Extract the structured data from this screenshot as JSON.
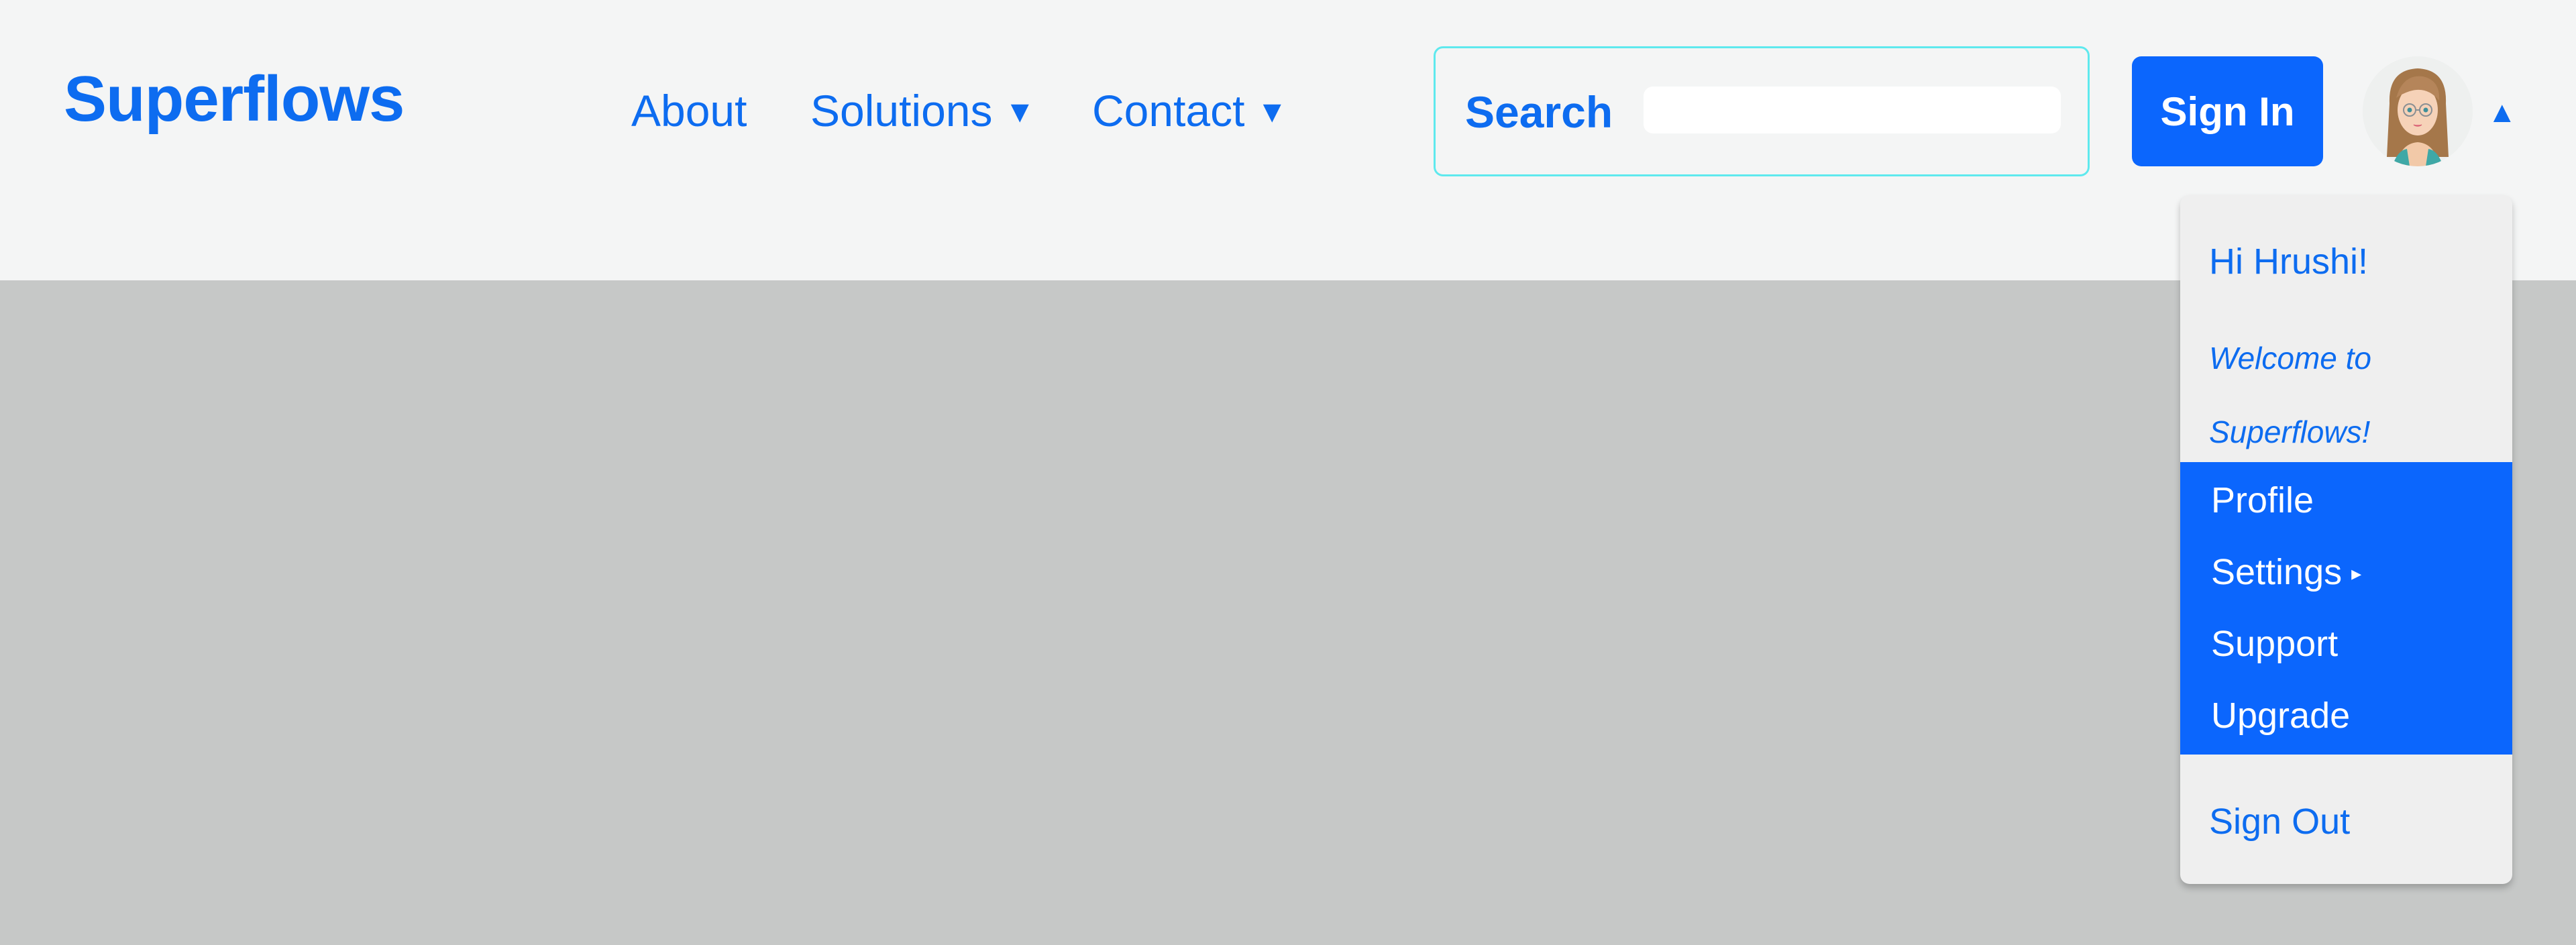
{
  "brand": {
    "name": "Superflows"
  },
  "nav": {
    "about": "About",
    "solutions": "Solutions",
    "contact": "Contact",
    "dropdown_caret": "▼"
  },
  "search": {
    "label": "Search",
    "value": "",
    "placeholder": ""
  },
  "auth": {
    "sign_in_label": "Sign In"
  },
  "user_menu": {
    "toggle_caret": "▲",
    "greeting": "Hi Hrushi!",
    "welcome_message": "Welcome to Superflows!",
    "items": [
      {
        "label": "Profile"
      },
      {
        "label": "Settings",
        "submenu_indicator": "▸"
      },
      {
        "label": "Support"
      },
      {
        "label": "Upgrade"
      }
    ],
    "sign_out_label": "Sign Out"
  },
  "colors": {
    "brand_blue": "#0d6cf0",
    "button_blue": "#0b66fd",
    "navbar_bg": "#f4f5f5",
    "page_bg": "#c6c8c7",
    "search_border": "#5ee9ee",
    "dropdown_bg": "#efefef"
  },
  "icons": {
    "avatar": "user-avatar-icon",
    "submenu": "chevron-right-icon",
    "caret_down": "caret-down-icon",
    "caret_up": "caret-up-icon"
  }
}
